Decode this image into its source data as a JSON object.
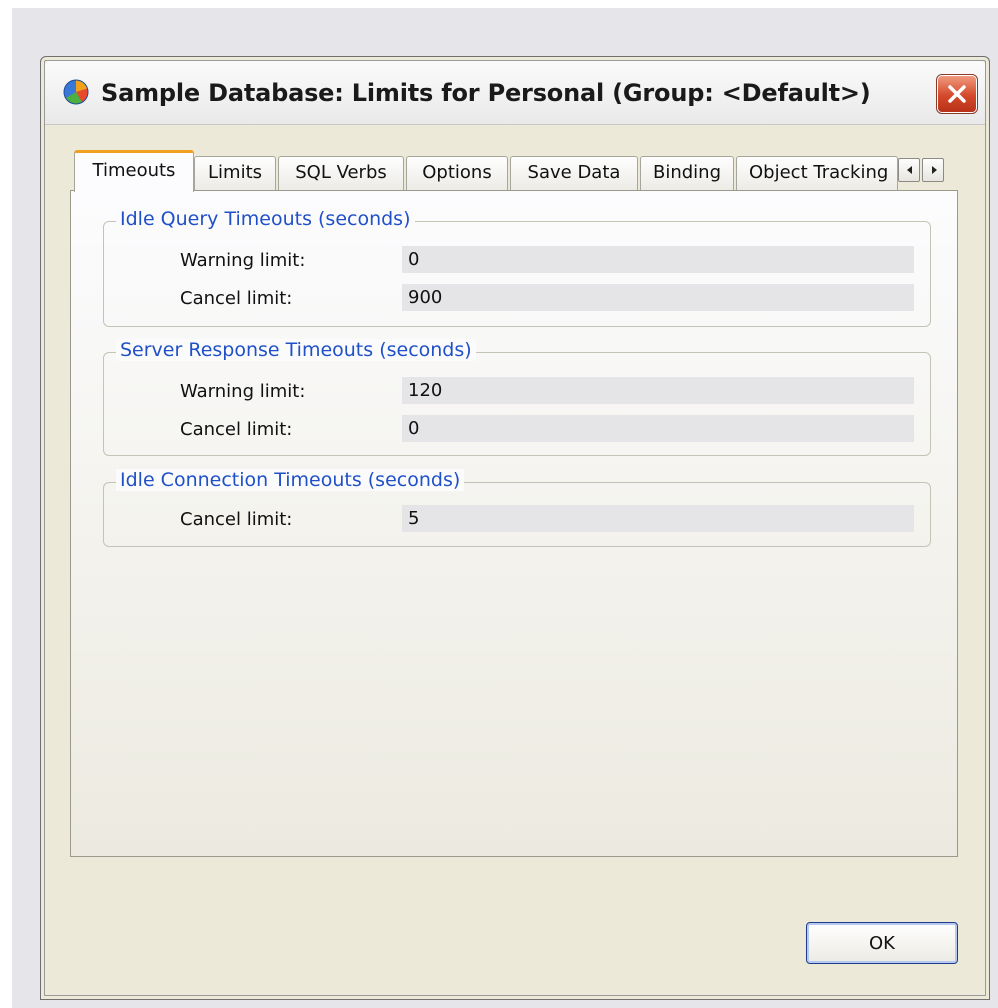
{
  "window": {
    "title": "Sample Database: Limits for Personal (Group: <Default>)"
  },
  "tabs": [
    {
      "label": "Timeouts",
      "active": true
    },
    {
      "label": "Limits"
    },
    {
      "label": "SQL Verbs"
    },
    {
      "label": "Options"
    },
    {
      "label": "Save Data"
    },
    {
      "label": "Binding"
    },
    {
      "label": "Object Tracking"
    }
  ],
  "groups": {
    "idle_query": {
      "title": "Idle Query Timeouts (seconds)",
      "warning_label": "Warning limit:",
      "warning_value": "0",
      "cancel_label": "Cancel limit:",
      "cancel_value": "900"
    },
    "server_response": {
      "title": "Server Response Timeouts (seconds)",
      "warning_label": "Warning limit:",
      "warning_value": "120",
      "cancel_label": "Cancel limit:",
      "cancel_value": "0"
    },
    "idle_connection": {
      "title": "Idle Connection Timeouts (seconds)",
      "cancel_label": "Cancel limit:",
      "cancel_value": "5"
    }
  },
  "buttons": {
    "ok": "OK"
  },
  "icons": {
    "app": "database-pie-icon",
    "close": "close-icon",
    "scroll_left": "arrow-left-icon",
    "scroll_right": "arrow-right-icon"
  },
  "colors": {
    "group_title": "#2050c8",
    "active_tab_accent": "#f0a020",
    "close_button": "#d4492a"
  }
}
